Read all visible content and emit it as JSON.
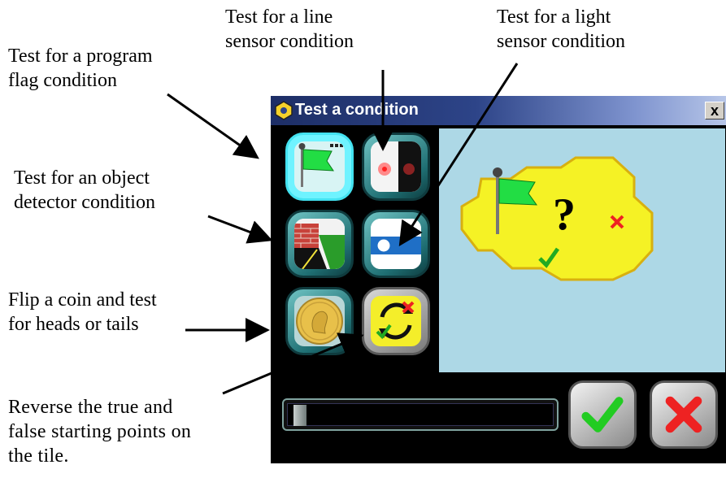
{
  "callouts": {
    "line_sensor": "Test for a line\nsensor condition",
    "light_sensor": "Test for a light\nsensor condition",
    "program_flag": "Test for a program\nflag condition",
    "object_detector": "Test for an object\ndetector condition",
    "coin_flip": "Flip a coin and test\nfor heads or tails",
    "reverse": "Reverse the true and\nfalse starting points on\nthe tile."
  },
  "window": {
    "title": "Test a condition",
    "close_label": "x"
  },
  "preview": {
    "question_mark": "?"
  },
  "slider": {
    "value": 0.02
  },
  "colors": {
    "preview_bg": "#add8e6",
    "tile_yellow": "#f5f225",
    "flag_green": "#22dd44",
    "ok_green": "#22cc22",
    "cancel_red": "#ee2222",
    "title_dark": "#1d2e66"
  }
}
